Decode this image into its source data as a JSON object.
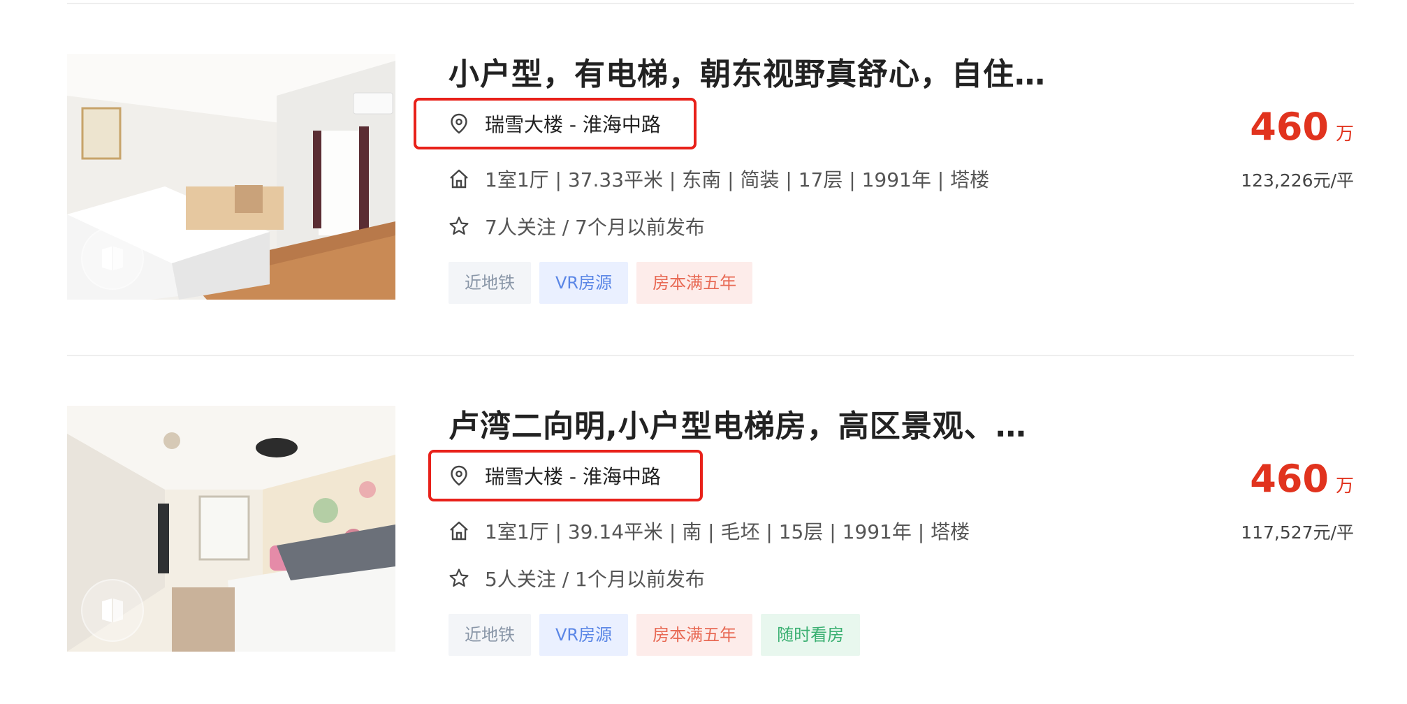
{
  "listings": [
    {
      "title": "小户型，有电梯，朝东视野真舒心，自住…",
      "address": "瑞雪大楼 - 淮海中路",
      "house_info": "1室1厅 | 37.33平米 | 东南 | 简装 | 17层 | 1991年 | 塔楼",
      "follow_info": "7人关注 / 7个月以前发布",
      "tags": [
        "近地铁",
        "VR房源",
        "房本满五年"
      ],
      "total_price": "460",
      "total_price_unit": "万",
      "unit_price": "123,226元/平"
    },
    {
      "title": "卢湾二向明,小户型电梯房，高区景观、…",
      "address": "瑞雪大楼 - 淮海中路",
      "house_info": "1室1厅 | 39.14平米 | 南 | 毛坯 | 15层 | 1991年 | 塔楼",
      "follow_info": "5人关注 / 1个月以前发布",
      "tags": [
        "近地铁",
        "VR房源",
        "房本满五年",
        "随时看房"
      ],
      "total_price": "460",
      "total_price_unit": "万",
      "unit_price": "117,527元/平"
    }
  ],
  "icons": {
    "address": "location-pin-icon",
    "house_info": "house-icon",
    "follow_info": "star-icon",
    "photo_badge": "vr-badge-icon"
  },
  "colors": {
    "price": "#e1331e",
    "highlight_box": "#e8211a",
    "tag_subway_text": "#8a97a8",
    "tag_vr_text": "#5a86e6",
    "tag_five_years_text": "#e86a55",
    "tag_anytime_text": "#3bb072"
  }
}
